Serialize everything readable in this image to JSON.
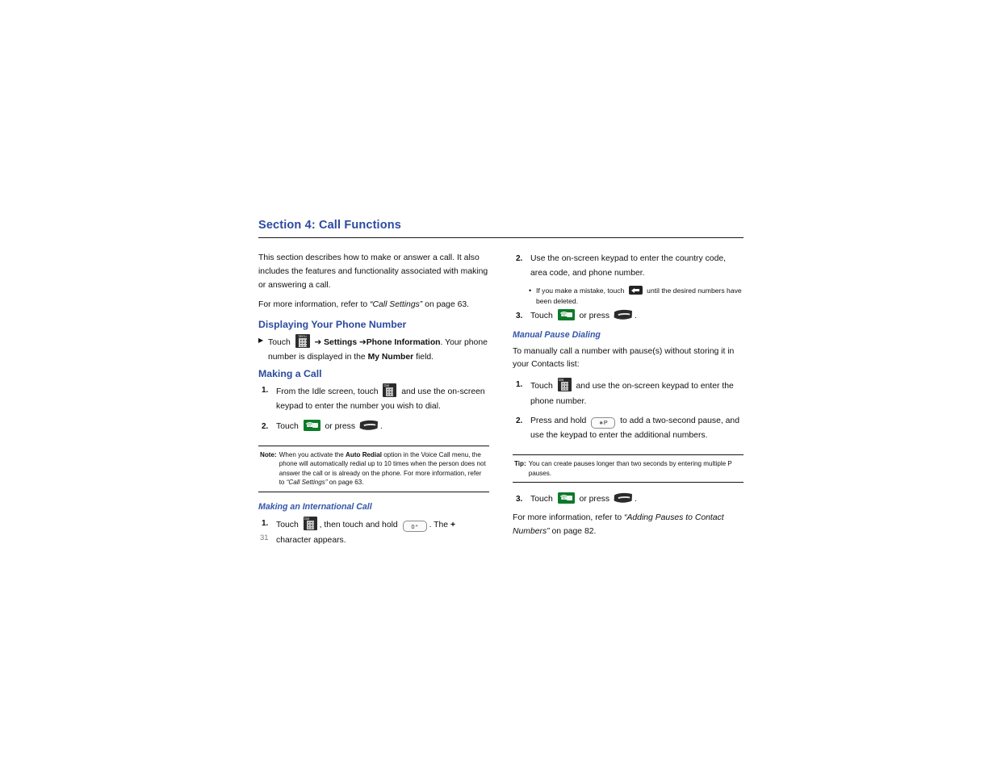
{
  "document": {
    "page_number": "31",
    "section_title": "Section 4: Call Functions",
    "accent_color": "#2b4aa0",
    "heading_color": "#3355ab"
  },
  "left_column": {
    "intro_paragraph": "This section describes how to make or answer a call. It also includes the features and functionality associated with making or answering a call.",
    "more_info": {
      "prefix": "For more information, refer to",
      "link_text": "“Call Settings”",
      "suffix": "on page 63."
    },
    "heading_displaying": "Displaying Your Phone Number",
    "displaying_step": {
      "marker": "▶",
      "text_1": "Touch",
      "icon_1": "menu-keypad-icon",
      "text_2": "➔",
      "bold_1": "Settings",
      "text_3": "➔",
      "bold_2": "Phone Information",
      "text_4": ". Your phone number is displayed in the",
      "bold_3": "My Number",
      "text_5": "field."
    },
    "heading_making_call": "Making a Call",
    "making_call_steps": [
      {
        "num": "1.",
        "text_1": "From the Idle screen, touch",
        "icon": "dial-keypad-icon",
        "text_2": "and use the on-screen keypad to enter the number you wish to dial."
      },
      {
        "num": "2.",
        "text_1": "Touch",
        "icon_1": "green-call-button-icon",
        "text_2": "or press",
        "icon_2": "send-key-icon",
        "text_3": "."
      }
    ],
    "note": {
      "label": "Note:",
      "text_1": "When you activate the",
      "bold_1": "Auto Redial",
      "text_2": "option in the Voice Call menu, the phone will automatically redial up to 10 times when the person does not answer the call or is already on the phone. For more information, refer to",
      "italic_1": "“Call Settings”",
      "text_3": "on page 63."
    },
    "heading_international": "Making an International Call",
    "international_step": {
      "num": "1.",
      "text_1": "Touch",
      "icon_1": "dial-keypad-icon",
      "text_2": ", then touch and hold",
      "key_label": "0",
      "key_sup": "+",
      "text_3": ". The",
      "bold_plus": "+",
      "text_4": "character appears."
    }
  },
  "right_column": {
    "steps_continued": [
      {
        "num": "2.",
        "text": "Use the on-screen keypad to enter the country code, area code, and phone number."
      }
    ],
    "sub_bullet": {
      "dot": "•",
      "text_1": "If you make a mistake, touch",
      "icon": "backspace-key-icon",
      "text_2": "until the desired numbers have been deleted."
    },
    "step_three": {
      "num": "3.",
      "text_1": "Touch",
      "icon_1": "green-call-button-icon",
      "text_2": "or press",
      "icon_2": "send-key-icon",
      "text_3": "."
    },
    "heading_manual_pause": "Manual Pause Dialing",
    "manual_pause_intro": "To manually call a number with pause(s) without storing it in your Contacts list:",
    "manual_pause_steps": [
      {
        "num": "1.",
        "text_1": "Touch",
        "icon": "dial-keypad-icon",
        "text_2": "and use the on-screen keypad to enter the phone number."
      },
      {
        "num": "2.",
        "text_1": "Press and hold",
        "key_label": "∗P",
        "text_2": "to add a two-second pause, and use the keypad to enter the additional numbers."
      }
    ],
    "tip": {
      "label": "Tip:",
      "text": "You can create pauses longer than two seconds by entering multiple P pauses."
    },
    "step_three_b": {
      "num": "3.",
      "text_1": "Touch",
      "icon_1": "green-call-button-icon",
      "text_2": "or press",
      "icon_2": "send-key-icon",
      "text_3": "."
    },
    "closing": {
      "prefix": "For more information, refer to",
      "link_text": "“Adding Pauses to Contact Numbers”",
      "suffix": "on page 82."
    }
  }
}
